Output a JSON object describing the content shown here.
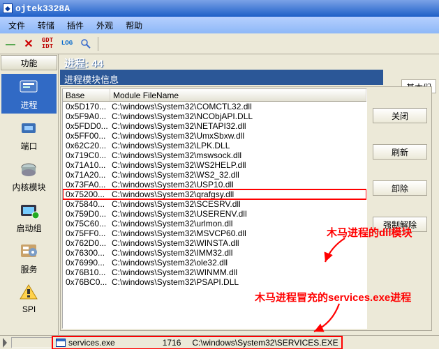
{
  "title": "ojtek3328A",
  "menu": [
    "文件",
    "转储",
    "插件",
    "外观",
    "帮助"
  ],
  "sidebar_tab": "功能",
  "sidebar": [
    {
      "label": "进程"
    },
    {
      "label": "端口"
    },
    {
      "label": "内核模块"
    },
    {
      "label": "启动组"
    },
    {
      "label": "服务"
    },
    {
      "label": "SPI"
    }
  ],
  "proc_header": "进程: 44",
  "proc_sub": "进程模块信息",
  "right_tab": "基本们",
  "cols": {
    "base": "Base",
    "file": "Module FileName"
  },
  "buttons": {
    "close": "关闭",
    "refresh": "刷新",
    "remove": "卸除",
    "force": "强制解除"
  },
  "rows": [
    {
      "b": "0x5D170...",
      "f": "C:\\windows\\System32\\COMCTL32.dll"
    },
    {
      "b": "0x5F9A0...",
      "f": "C:\\windows\\System32\\NCObjAPI.DLL"
    },
    {
      "b": "0x5FDD0...",
      "f": "C:\\windows\\System32\\NETAPI32.dll"
    },
    {
      "b": "0x5FF00...",
      "f": "C:\\windows\\System32\\UmxSbxw.dll"
    },
    {
      "b": "0x62C20...",
      "f": "C:\\windows\\System32\\LPK.DLL"
    },
    {
      "b": "0x719C0...",
      "f": "C:\\windows\\System32\\mswsock.dll"
    },
    {
      "b": "0x71A10...",
      "f": "C:\\windows\\System32\\WS2HELP.dll"
    },
    {
      "b": "0x71A20...",
      "f": "C:\\windows\\System32\\WS2_32.dll"
    },
    {
      "b": "0x73FA0...",
      "f": "C:\\windows\\System32\\USP10.dll"
    },
    {
      "b": "0x75200...",
      "f": "C:\\windows\\System32\\qrafgsy.dll",
      "hl": true
    },
    {
      "b": "0x75840...",
      "f": "C:\\windows\\System32\\SCESRV.dll"
    },
    {
      "b": "0x759D0...",
      "f": "C:\\windows\\System32\\USERENV.dll"
    },
    {
      "b": "0x75C60...",
      "f": "C:\\windows\\System32\\urlmon.dll"
    },
    {
      "b": "0x75FF0...",
      "f": "C:\\windows\\System32\\MSVCP60.dll"
    },
    {
      "b": "0x762D0...",
      "f": "C:\\windows\\System32\\WINSTA.dll"
    },
    {
      "b": "0x76300...",
      "f": "C:\\windows\\System32\\IMM32.dll"
    },
    {
      "b": "0x76990...",
      "f": "C:\\windows\\System32\\ole32.dll"
    },
    {
      "b": "0x76B10...",
      "f": "C:\\windows\\System32\\WINMM.dll"
    },
    {
      "b": "0x76BC0...",
      "f": "C:\\windows\\System32\\PSAPI.DLL"
    }
  ],
  "anno1": "木马进程的dll模块",
  "anno2": "木马进程冒充的services.exe进程",
  "status": {
    "name": "services.exe",
    "pid": "1716",
    "path": "C:\\windows\\System32\\SERVICES.EXE"
  }
}
